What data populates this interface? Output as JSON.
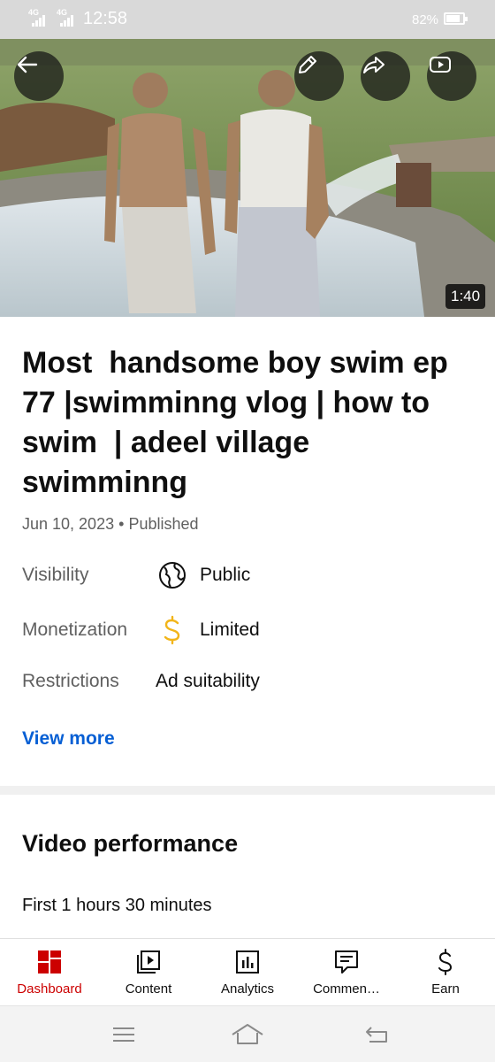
{
  "status_bar": {
    "network_1": "4G",
    "network_2": "4G",
    "time": "12:58",
    "battery_percent": "82%",
    "battery_level": 0.82
  },
  "video": {
    "duration": "1:40",
    "title": "Most  handsome boy swim ep 77 |swimminng vlog | how to swim  | adeel village swimminng",
    "date": "Jun 10, 2023",
    "separator": "•",
    "status": "Published",
    "overlay_buttons": [
      "back-arrow-icon",
      "pencil-icon",
      "share-icon",
      "youtube-icon"
    ]
  },
  "details": {
    "visibility_label": "Visibility",
    "visibility_value": "Public",
    "visibility_icon": "globe-icon",
    "monetization_label": "Monetization",
    "monetization_value": "Limited",
    "monetization_icon": "dollar-icon",
    "monetization_color": "#f2b519",
    "restrictions_label": "Restrictions",
    "restrictions_value": "Ad suitability",
    "view_more": "View more"
  },
  "performance": {
    "title": "Video performance",
    "subtitle": "First 1 hours 30 minutes"
  },
  "tabs": [
    {
      "label": "Dashboard",
      "icon": "dashboard-icon",
      "active": true
    },
    {
      "label": "Content",
      "icon": "content-icon",
      "active": false
    },
    {
      "label": "Analytics",
      "icon": "analytics-icon",
      "active": false
    },
    {
      "label": "Commen…",
      "icon": "comments-icon",
      "active": false
    },
    {
      "label": "Earn",
      "icon": "earn-icon",
      "active": false
    }
  ],
  "colors": {
    "accent_red": "#cc0000",
    "link_blue": "#065fd4"
  }
}
